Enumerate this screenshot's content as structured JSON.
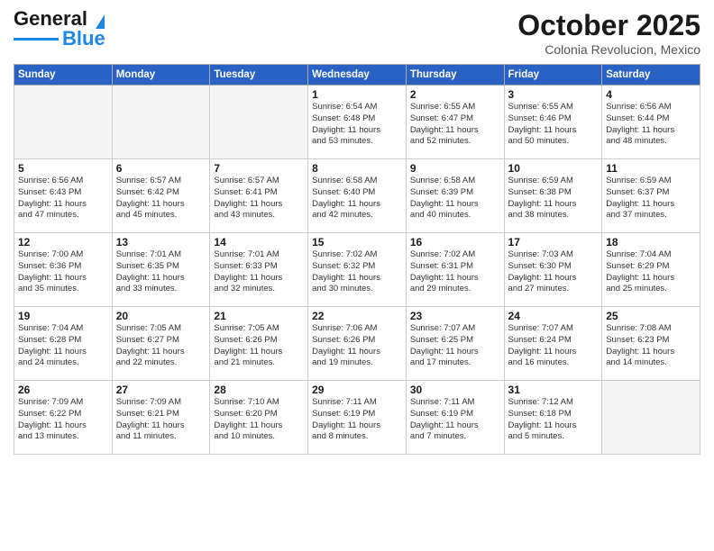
{
  "header": {
    "logo_line1": "General",
    "logo_line2": "Blue",
    "month": "October 2025",
    "location": "Colonia Revolucion, Mexico"
  },
  "weekdays": [
    "Sunday",
    "Monday",
    "Tuesday",
    "Wednesday",
    "Thursday",
    "Friday",
    "Saturday"
  ],
  "weeks": [
    [
      {
        "day": "",
        "info": ""
      },
      {
        "day": "",
        "info": ""
      },
      {
        "day": "",
        "info": ""
      },
      {
        "day": "1",
        "info": "Sunrise: 6:54 AM\nSunset: 6:48 PM\nDaylight: 11 hours\nand 53 minutes."
      },
      {
        "day": "2",
        "info": "Sunrise: 6:55 AM\nSunset: 6:47 PM\nDaylight: 11 hours\nand 52 minutes."
      },
      {
        "day": "3",
        "info": "Sunrise: 6:55 AM\nSunset: 6:46 PM\nDaylight: 11 hours\nand 50 minutes."
      },
      {
        "day": "4",
        "info": "Sunrise: 6:56 AM\nSunset: 6:44 PM\nDaylight: 11 hours\nand 48 minutes."
      }
    ],
    [
      {
        "day": "5",
        "info": "Sunrise: 6:56 AM\nSunset: 6:43 PM\nDaylight: 11 hours\nand 47 minutes."
      },
      {
        "day": "6",
        "info": "Sunrise: 6:57 AM\nSunset: 6:42 PM\nDaylight: 11 hours\nand 45 minutes."
      },
      {
        "day": "7",
        "info": "Sunrise: 6:57 AM\nSunset: 6:41 PM\nDaylight: 11 hours\nand 43 minutes."
      },
      {
        "day": "8",
        "info": "Sunrise: 6:58 AM\nSunset: 6:40 PM\nDaylight: 11 hours\nand 42 minutes."
      },
      {
        "day": "9",
        "info": "Sunrise: 6:58 AM\nSunset: 6:39 PM\nDaylight: 11 hours\nand 40 minutes."
      },
      {
        "day": "10",
        "info": "Sunrise: 6:59 AM\nSunset: 6:38 PM\nDaylight: 11 hours\nand 38 minutes."
      },
      {
        "day": "11",
        "info": "Sunrise: 6:59 AM\nSunset: 6:37 PM\nDaylight: 11 hours\nand 37 minutes."
      }
    ],
    [
      {
        "day": "12",
        "info": "Sunrise: 7:00 AM\nSunset: 6:36 PM\nDaylight: 11 hours\nand 35 minutes."
      },
      {
        "day": "13",
        "info": "Sunrise: 7:01 AM\nSunset: 6:35 PM\nDaylight: 11 hours\nand 33 minutes."
      },
      {
        "day": "14",
        "info": "Sunrise: 7:01 AM\nSunset: 6:33 PM\nDaylight: 11 hours\nand 32 minutes."
      },
      {
        "day": "15",
        "info": "Sunrise: 7:02 AM\nSunset: 6:32 PM\nDaylight: 11 hours\nand 30 minutes."
      },
      {
        "day": "16",
        "info": "Sunrise: 7:02 AM\nSunset: 6:31 PM\nDaylight: 11 hours\nand 29 minutes."
      },
      {
        "day": "17",
        "info": "Sunrise: 7:03 AM\nSunset: 6:30 PM\nDaylight: 11 hours\nand 27 minutes."
      },
      {
        "day": "18",
        "info": "Sunrise: 7:04 AM\nSunset: 6:29 PM\nDaylight: 11 hours\nand 25 minutes."
      }
    ],
    [
      {
        "day": "19",
        "info": "Sunrise: 7:04 AM\nSunset: 6:28 PM\nDaylight: 11 hours\nand 24 minutes."
      },
      {
        "day": "20",
        "info": "Sunrise: 7:05 AM\nSunset: 6:27 PM\nDaylight: 11 hours\nand 22 minutes."
      },
      {
        "day": "21",
        "info": "Sunrise: 7:05 AM\nSunset: 6:26 PM\nDaylight: 11 hours\nand 21 minutes."
      },
      {
        "day": "22",
        "info": "Sunrise: 7:06 AM\nSunset: 6:26 PM\nDaylight: 11 hours\nand 19 minutes."
      },
      {
        "day": "23",
        "info": "Sunrise: 7:07 AM\nSunset: 6:25 PM\nDaylight: 11 hours\nand 17 minutes."
      },
      {
        "day": "24",
        "info": "Sunrise: 7:07 AM\nSunset: 6:24 PM\nDaylight: 11 hours\nand 16 minutes."
      },
      {
        "day": "25",
        "info": "Sunrise: 7:08 AM\nSunset: 6:23 PM\nDaylight: 11 hours\nand 14 minutes."
      }
    ],
    [
      {
        "day": "26",
        "info": "Sunrise: 7:09 AM\nSunset: 6:22 PM\nDaylight: 11 hours\nand 13 minutes."
      },
      {
        "day": "27",
        "info": "Sunrise: 7:09 AM\nSunset: 6:21 PM\nDaylight: 11 hours\nand 11 minutes."
      },
      {
        "day": "28",
        "info": "Sunrise: 7:10 AM\nSunset: 6:20 PM\nDaylight: 11 hours\nand 10 minutes."
      },
      {
        "day": "29",
        "info": "Sunrise: 7:11 AM\nSunset: 6:19 PM\nDaylight: 11 hours\nand 8 minutes."
      },
      {
        "day": "30",
        "info": "Sunrise: 7:11 AM\nSunset: 6:19 PM\nDaylight: 11 hours\nand 7 minutes."
      },
      {
        "day": "31",
        "info": "Sunrise: 7:12 AM\nSunset: 6:18 PM\nDaylight: 11 hours\nand 5 minutes."
      },
      {
        "day": "",
        "info": ""
      }
    ]
  ]
}
